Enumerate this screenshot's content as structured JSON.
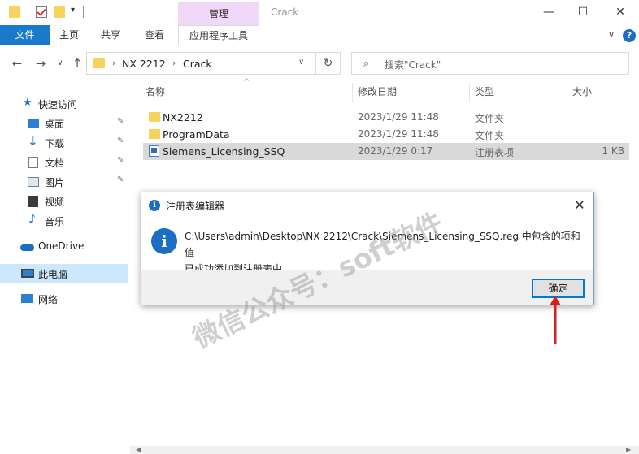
{
  "titlebar": {
    "manage_tab": "管理",
    "title": "Crack",
    "minimize": "—",
    "maximize": "☐",
    "close": "✕"
  },
  "ribbon": {
    "tabs": [
      "文件",
      "主页",
      "共享",
      "查看",
      "应用程序工具"
    ],
    "expand": "∨",
    "help": "?"
  },
  "address": {
    "path": [
      "NX 2212",
      "Crack"
    ],
    "separator": "›",
    "search_placeholder": "搜索\"Crack\""
  },
  "sidebar": {
    "items": [
      {
        "label": "快速访问",
        "icon": "star-icon",
        "color": "#1b6ec2"
      },
      {
        "label": "桌面",
        "icon": "desktop-icon",
        "pinned": true,
        "color": "#2d7fd3"
      },
      {
        "label": "下载",
        "icon": "download-icon",
        "pinned": true,
        "color": "#2d7fd3"
      },
      {
        "label": "文档",
        "icon": "documents-icon",
        "pinned": true,
        "color": "#6f7c8a"
      },
      {
        "label": "图片",
        "icon": "pictures-icon",
        "pinned": true,
        "color": "#6f7c8a"
      },
      {
        "label": "视频",
        "icon": "videos-icon",
        "color": "#3a3a3a"
      },
      {
        "label": "音乐",
        "icon": "music-icon",
        "color": "#2d7fd3"
      },
      {
        "label": "OneDrive",
        "icon": "onedrive-icon",
        "color": "#1b6ec2"
      },
      {
        "label": "此电脑",
        "icon": "pc-icon",
        "selected": true,
        "color": "#2d7fd3"
      },
      {
        "label": "网络",
        "icon": "network-icon",
        "color": "#2d7fd3"
      }
    ],
    "pin_glyph": "📌"
  },
  "columns": [
    "名称",
    "修改日期",
    "类型",
    "大小"
  ],
  "files": [
    {
      "name": "NX2212",
      "date": "2023/1/29 11:48",
      "type": "文件夹",
      "size": "",
      "kind": "folder"
    },
    {
      "name": "ProgramData",
      "date": "2023/1/29 11:48",
      "type": "文件夹",
      "size": "",
      "kind": "folder"
    },
    {
      "name": "Siemens_Licensing_SSQ",
      "date": "2023/1/29 0:17",
      "type": "注册表项",
      "size": "1 KB",
      "kind": "reg",
      "selected": true
    }
  ],
  "dialog": {
    "title": "注册表编辑器",
    "message_line1": "C:\\Users\\admin\\Desktop\\NX 2212\\Crack\\Siemens_Licensing_SSQ.reg 中包含的项和值",
    "message_line2": "已成功添加到注册表中。",
    "ok_label": "确定",
    "close": "✕"
  },
  "watermark": "微信公众号：soft软件",
  "colors": {
    "accent": "#1979ca",
    "manage_tab": "#f0d9f8",
    "selection": "#cce8ff",
    "arrow": "#d42020"
  }
}
